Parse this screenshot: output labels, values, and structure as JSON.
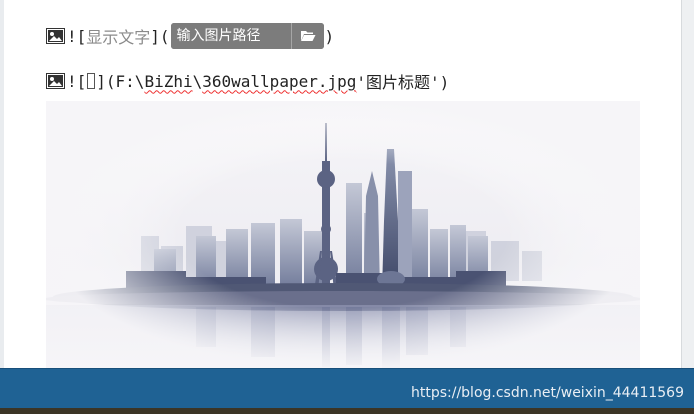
{
  "editor": {
    "line1": {
      "bang_open": "![",
      "alt_text": "显示文字",
      "bracket_paren": "](",
      "path_placeholder": "输入图片路径",
      "close_paren": ")"
    },
    "line2": {
      "bang_open": "![",
      "bracket_paren": "](",
      "path_prefix": "F:\\",
      "path_dir": "BiZhi",
      "path_sep": "\\",
      "filename": "360wallpaper.jpg",
      "title": " '图片标题')"
    },
    "image_preview": {
      "subject": "Shanghai skyline reflected in water",
      "colors": {
        "sky": "#f3f2f5",
        "buildings": "#7e89a8",
        "reflection": "#aeb2c9"
      }
    }
  },
  "footer": {
    "watermark": "https://blog.csdn.net/weixin_44411569",
    "color": "#1f6294"
  },
  "icons": {
    "image_icon": "image-icon",
    "folder_icon": "folder-open-icon"
  }
}
